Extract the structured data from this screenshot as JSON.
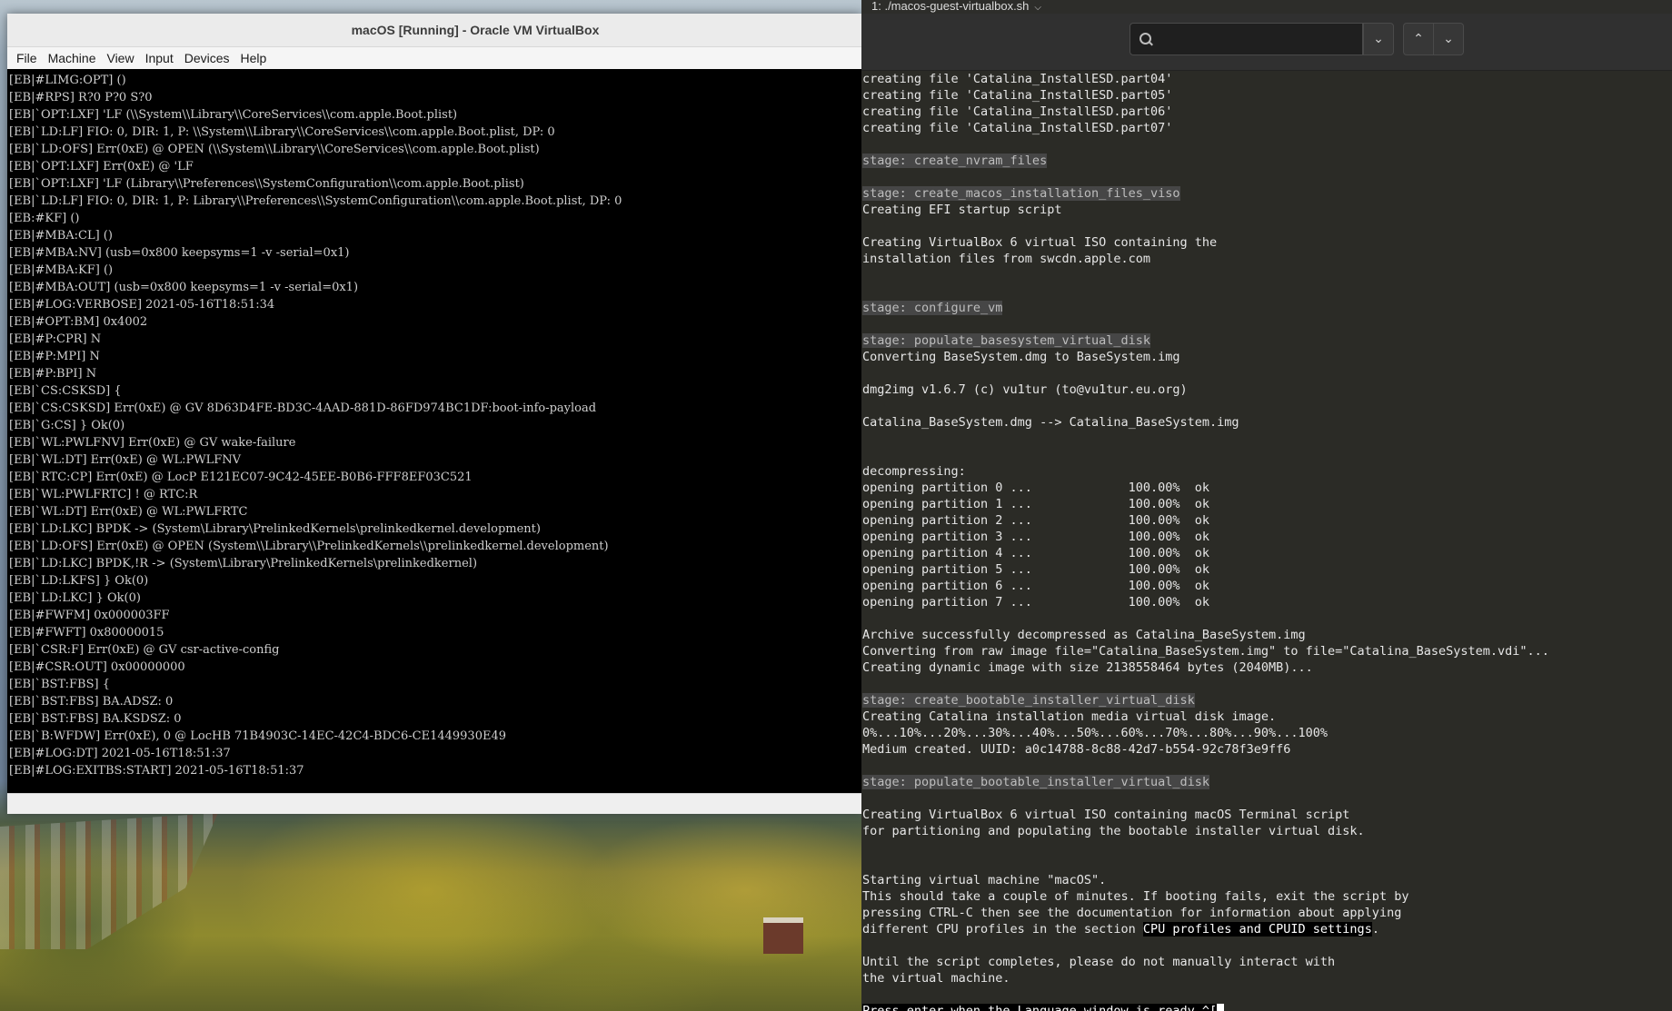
{
  "vbox": {
    "title": "macOS [Running] - Oracle VM VirtualBox",
    "menu": [
      "File",
      "Machine",
      "View",
      "Input",
      "Devices",
      "Help"
    ],
    "boot_log": [
      "[EB|#LIMG:OPT] ()",
      "[EB|#RPS] R?0 P?0 S?0",
      "[EB|`OPT:LXF] 'LF (\\\\System\\\\Library\\\\CoreServices\\\\com.apple.Boot.plist)",
      "[EB|`LD:LF] FIO: 0, DIR: 1, P: \\\\System\\\\Library\\\\CoreServices\\\\com.apple.Boot.plist, DP: 0",
      "[EB|`LD:OFS] Err(0xE) @ OPEN (\\\\System\\\\Library\\\\CoreServices\\\\com.apple.Boot.plist)",
      "[EB|`OPT:LXF] Err(0xE) @ 'LF",
      "[EB|`OPT:LXF] 'LF (Library\\\\Preferences\\\\SystemConfiguration\\\\com.apple.Boot.plist)",
      "[EB|`LD:LF] FIO: 0, DIR: 1, P: Library\\\\Preferences\\\\SystemConfiguration\\\\com.apple.Boot.plist, DP: 0",
      "[EB:#KF] ()",
      "[EB|#MBA:CL] ()",
      "[EB|#MBA:NV] (usb=0x800 keepsyms=1 -v -serial=0x1)",
      "[EB|#MBA:KF] ()",
      "[EB|#MBA:OUT] (usb=0x800 keepsyms=1 -v -serial=0x1)",
      "[EB|#LOG:VERBOSE] 2021-05-16T18:51:34",
      "[EB|#OPT:BM] 0x4002",
      "[EB|#P:CPR] N",
      "[EB|#P:MPI] N",
      "[EB|#P:BPI] N",
      "[EB|`CS:CSKSD] {",
      "[EB|`CS:CSKSD] Err(0xE) @ GV 8D63D4FE-BD3C-4AAD-881D-86FD974BC1DF:boot-info-payload",
      "[EB|`G:CS] } Ok(0)",
      "[EB|`WL:PWLFNV] Err(0xE) @ GV wake-failure",
      "[EB|`WL:DT] Err(0xE) @ WL:PWLFNV",
      "[EB|`RTC:CP] Err(0xE) @ LocP E121EC07-9C42-45EE-B0B6-FFF8EF03C521",
      "[EB|`WL:PWLFRTC] ! @ RTC:R",
      "[EB|`WL:DT] Err(0xE) @ WL:PWLFRTC",
      "[EB|`LD:LKC] BPDK -> (System\\Library\\PrelinkedKernels\\prelinkedkernel.development)",
      "[EB|`LD:OFS] Err(0xE) @ OPEN (System\\\\Library\\\\PrelinkedKernels\\\\prelinkedkernel.development)",
      "[EB|`LD:LKC] BPDK,!R -> (System\\Library\\PrelinkedKernels\\prelinkedkernel)",
      "[EB|`LD:LKFS] } Ok(0)",
      "[EB|`LD:LKC] } Ok(0)",
      "[EB|#FWFM] 0x000003FF",
      "[EB|#FWFT] 0x80000015",
      "[EB|`CSR:F] Err(0xE) @ GV csr-active-config",
      "[EB|#CSR:OUT] 0x00000000",
      "[EB|`BST:FBS] {",
      "[EB|`BST:FBS] BA.ADSZ: 0",
      "[EB|`BST:FBS] BA.KSDSZ: 0",
      "[EB|`B:WFDW] Err(0xE), 0 @ LocHB 71B4903C-14EC-42C4-BDC6-CE1449930E49",
      "[EB|#LOG:DT] 2021-05-16T18:51:37",
      "[EB|#LOG:EXITBS:START] 2021-05-16T18:51:37"
    ]
  },
  "terminal": {
    "tab_title": "1: ./macos-guest-virtualbox.sh",
    "search": {
      "placeholder": "",
      "value": ""
    },
    "lines": [
      {
        "text": "creating file 'Catalina_InstallESD.part04'",
        "style": "normal"
      },
      {
        "text": "creating file 'Catalina_InstallESD.part05'",
        "style": "normal"
      },
      {
        "text": "creating file 'Catalina_InstallESD.part06'",
        "style": "normal"
      },
      {
        "text": "creating file 'Catalina_InstallESD.part07'",
        "style": "normal"
      },
      {
        "text": "",
        "style": "normal"
      },
      {
        "text": "stage: create_nvram_files",
        "style": "stage"
      },
      {
        "text": "",
        "style": "normal"
      },
      {
        "text": "stage: create_macos_installation_files_viso",
        "style": "stage"
      },
      {
        "text": "Creating EFI startup script",
        "style": "normal"
      },
      {
        "text": "",
        "style": "normal"
      },
      {
        "text": "Creating VirtualBox 6 virtual ISO containing the",
        "style": "normal"
      },
      {
        "text": "installation files from swcdn.apple.com",
        "style": "normal"
      },
      {
        "text": "",
        "style": "normal"
      },
      {
        "text": "",
        "style": "normal"
      },
      {
        "text": "stage: configure_vm",
        "style": "stage"
      },
      {
        "text": "",
        "style": "normal"
      },
      {
        "text": "stage: populate_basesystem_virtual_disk",
        "style": "stage"
      },
      {
        "text": "Converting BaseSystem.dmg to BaseSystem.img",
        "style": "normal"
      },
      {
        "text": "",
        "style": "normal"
      },
      {
        "text": "dmg2img v1.6.7 (c) vu1tur (to@vu1tur.eu.org)",
        "style": "normal"
      },
      {
        "text": "",
        "style": "normal"
      },
      {
        "text": "Catalina_BaseSystem.dmg --> Catalina_BaseSystem.img",
        "style": "normal"
      },
      {
        "text": "",
        "style": "normal"
      },
      {
        "text": "",
        "style": "normal"
      },
      {
        "text": "decompressing:",
        "style": "normal"
      },
      {
        "text": "opening partition 0 ...             100.00%  ok",
        "style": "normal"
      },
      {
        "text": "opening partition 1 ...             100.00%  ok",
        "style": "normal"
      },
      {
        "text": "opening partition 2 ...             100.00%  ok",
        "style": "normal"
      },
      {
        "text": "opening partition 3 ...             100.00%  ok",
        "style": "normal"
      },
      {
        "text": "opening partition 4 ...             100.00%  ok",
        "style": "normal"
      },
      {
        "text": "opening partition 5 ...             100.00%  ok",
        "style": "normal"
      },
      {
        "text": "opening partition 6 ...             100.00%  ok",
        "style": "normal"
      },
      {
        "text": "opening partition 7 ...             100.00%  ok",
        "style": "normal"
      },
      {
        "text": "",
        "style": "normal"
      },
      {
        "text": "Archive successfully decompressed as Catalina_BaseSystem.img",
        "style": "normal"
      },
      {
        "text": "Converting from raw image file=\"Catalina_BaseSystem.img\" to file=\"Catalina_BaseSystem.vdi\"...",
        "style": "normal"
      },
      {
        "text": "Creating dynamic image with size 2138558464 bytes (2040MB)...",
        "style": "normal"
      },
      {
        "text": "",
        "style": "normal"
      },
      {
        "text": "stage: create_bootable_installer_virtual_disk",
        "style": "stage"
      },
      {
        "text": "Creating Catalina installation media virtual disk image.",
        "style": "normal"
      },
      {
        "text": "0%...10%...20%...30%...40%...50%...60%...70%...80%...90%...100%",
        "style": "normal"
      },
      {
        "text": "Medium created. UUID: a0c14788-8c88-42d7-b554-92c78f3e9ff6",
        "style": "normal"
      },
      {
        "text": "",
        "style": "normal"
      },
      {
        "text": "stage: populate_bootable_installer_virtual_disk",
        "style": "stage"
      },
      {
        "text": "",
        "style": "normal"
      },
      {
        "text": "Creating VirtualBox 6 virtual ISO containing macOS Terminal script",
        "style": "normal"
      },
      {
        "text": "for partitioning and populating the bootable installer virtual disk.",
        "style": "normal"
      },
      {
        "text": "",
        "style": "normal"
      },
      {
        "text": "",
        "style": "normal"
      },
      {
        "text": "Starting virtual machine \"macOS\".",
        "style": "normal"
      },
      {
        "text": "This should take a couple of minutes. If booting fails, exit the script by",
        "style": "normal"
      },
      {
        "text": "pressing CTRL-C then see the documentation for information about applying",
        "style": "normal"
      },
      {
        "text": "different CPU profiles in the section ",
        "style": "normal",
        "highlight": "CPU profiles and CPUID settings",
        "after": "."
      },
      {
        "text": "",
        "style": "normal"
      },
      {
        "text": "Until the script completes, please do not manually interact with",
        "style": "normal"
      },
      {
        "text": "the virtual machine.",
        "style": "normal"
      },
      {
        "text": "",
        "style": "normal"
      },
      {
        "text": "Press enter when the Language window is ready.^[",
        "style": "prompt",
        "cursor": true
      }
    ]
  }
}
